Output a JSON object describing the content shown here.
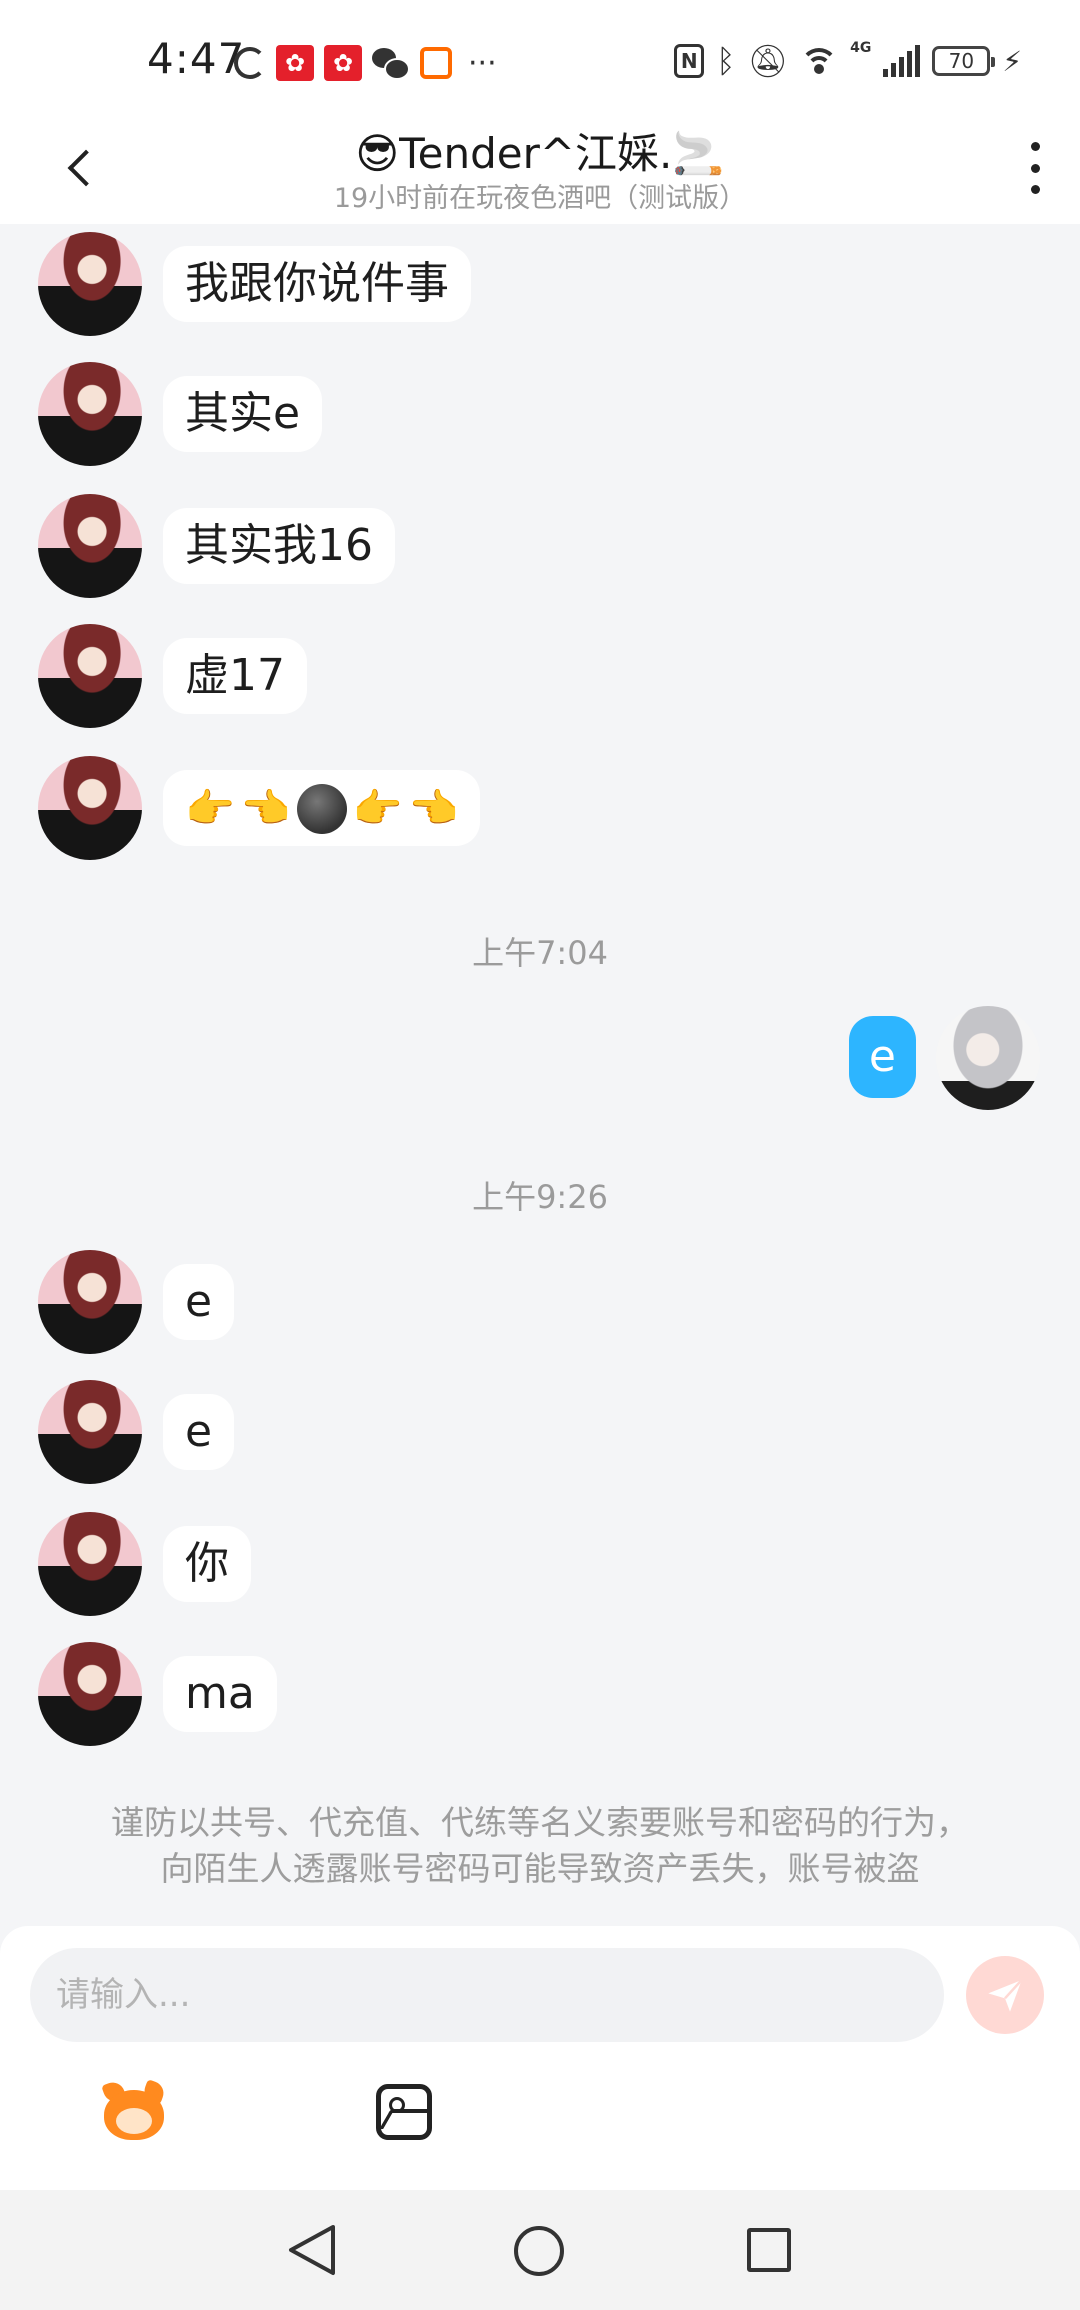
{
  "status_bar": {
    "time": "4:47",
    "network_type": "4G",
    "battery": "70",
    "more_indicator": "···"
  },
  "header": {
    "title": "😎Tender^江婇.🚬",
    "subtitle": "19小时前在玩夜色酒吧（测试版）"
  },
  "messages": [
    {
      "sender": "other",
      "text": "我跟你说件事"
    },
    {
      "sender": "other",
      "text": "其实e"
    },
    {
      "sender": "other",
      "text": "其实我16"
    },
    {
      "sender": "other",
      "text": "虚17"
    },
    {
      "sender": "other",
      "emoji": [
        "👉",
        "👈",
        "🌚",
        "👉",
        "👈"
      ]
    },
    {
      "sender": "me",
      "text": "e"
    },
    {
      "sender": "other",
      "text": "e"
    },
    {
      "sender": "other",
      "text": "e"
    },
    {
      "sender": "other",
      "text": "你"
    },
    {
      "sender": "other",
      "text": "ma"
    }
  ],
  "timestamps": [
    "上午7:04",
    "上午9:26"
  ],
  "warning": {
    "line1": "谨防以共号、代充值、代练等名义索要账号和密码的行为，",
    "line2": "向陌生人透露账号密码可能导致资产丢失，账号被盗"
  },
  "input": {
    "placeholder": "请输入..."
  },
  "colors": {
    "my_bubble": "#2db5ff",
    "send_button": "#ffd9d4",
    "background": "#f4f5f7"
  },
  "icons": [
    "back-icon",
    "more-icon",
    "send-icon",
    "sticker-icon",
    "image-icon",
    "nav-back-icon",
    "nav-home-icon",
    "nav-recent-icon"
  ]
}
